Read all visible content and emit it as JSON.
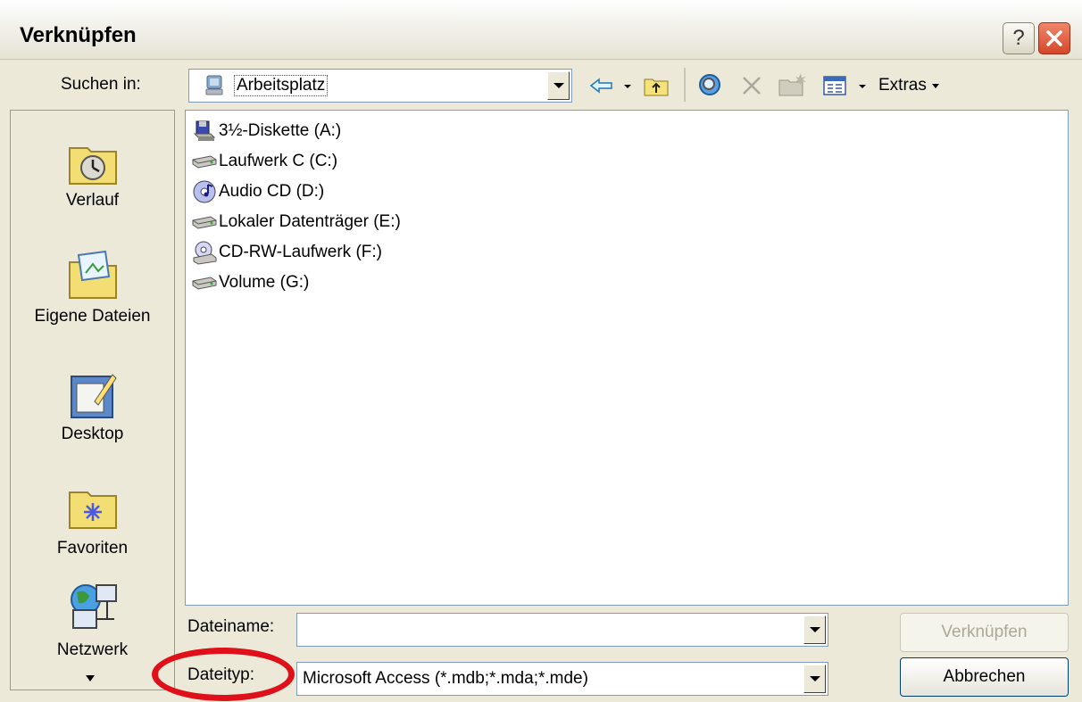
{
  "window": {
    "title": "Verknüpfen",
    "help_label": "?"
  },
  "toolbar": {
    "look_in_label": "Suchen in:",
    "look_in_value": "Arbeitsplatz",
    "tools_label": "Extras"
  },
  "places": [
    {
      "label": "Verlauf"
    },
    {
      "label": "Eigene Dateien"
    },
    {
      "label": "Desktop"
    },
    {
      "label": "Favoriten"
    },
    {
      "label": "Netzwerk"
    }
  ],
  "files": [
    {
      "label": "3½-Diskette (A:)",
      "icon": "floppy-drive-icon"
    },
    {
      "label": "Laufwerk C (C:)",
      "icon": "hard-drive-icon"
    },
    {
      "label": "Audio CD (D:)",
      "icon": "audio-cd-icon"
    },
    {
      "label": "Lokaler Datenträger (E:)",
      "icon": "hard-drive-icon"
    },
    {
      "label": "CD-RW-Laufwerk (F:)",
      "icon": "cd-rw-drive-icon"
    },
    {
      "label": "Volume (G:)",
      "icon": "hard-drive-icon"
    }
  ],
  "bottom": {
    "filename_label": "Dateiname:",
    "filename_value": "",
    "filetype_label": "Dateityp:",
    "filetype_value": "Microsoft Access (*.mdb;*.mda;*.mde)",
    "link_button": "Verknüpfen",
    "cancel_button": "Abbrechen"
  },
  "colors": {
    "highlight_ellipse": "#e0101a",
    "selection": "#316ac5"
  }
}
